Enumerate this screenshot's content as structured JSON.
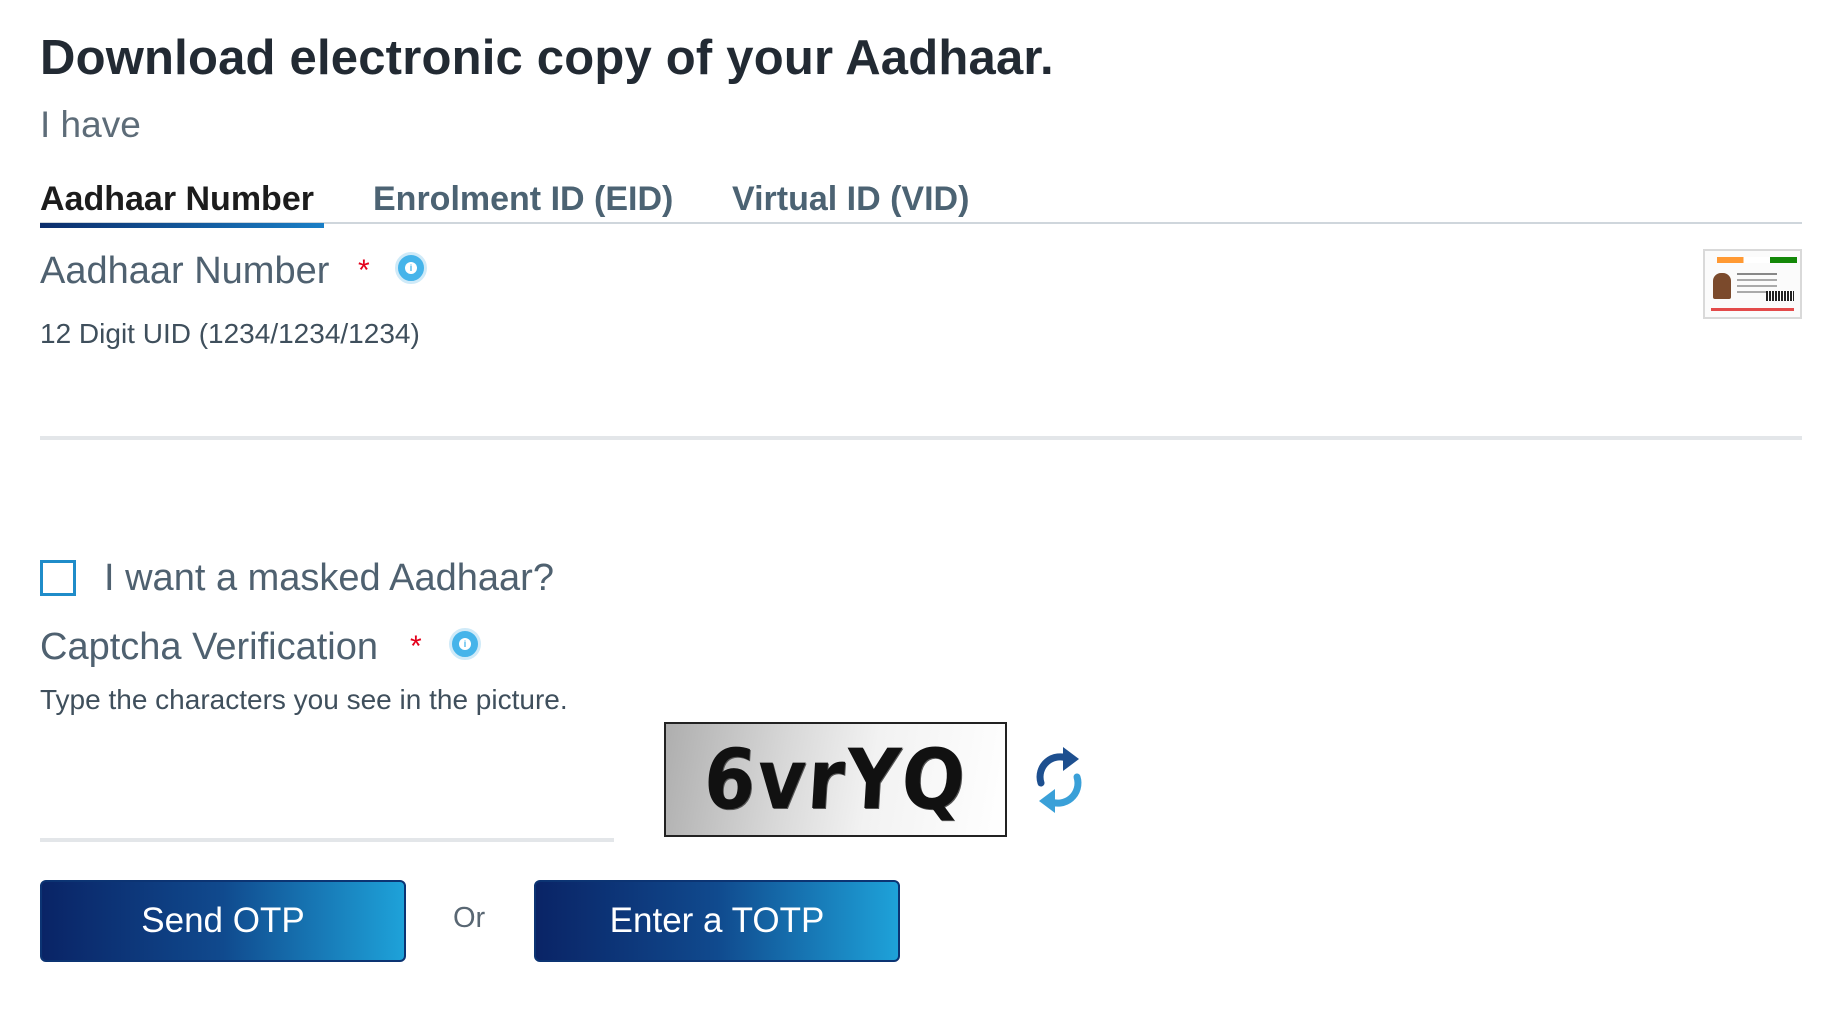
{
  "header": {
    "title": "Download electronic copy of your Aadhaar.",
    "subtitle": "I have"
  },
  "tabs": [
    {
      "label": "Aadhaar Number",
      "active": true
    },
    {
      "label": "Enrolment ID (EID)",
      "active": false
    },
    {
      "label": "Virtual ID (VID)",
      "active": false
    }
  ],
  "aadhaar_field": {
    "label": "Aadhaar Number",
    "required_mark": "*",
    "hint": "12 Digit UID (1234/1234/1234)",
    "value": "",
    "info_icon": "info-icon",
    "card_icon": "aadhaar-card-icon"
  },
  "masked": {
    "label": "I want a masked Aadhaar?",
    "checked": false
  },
  "captcha": {
    "label": "Captcha Verification",
    "required_mark": "*",
    "hint": "Type the characters you see in the picture.",
    "value": "",
    "image_text": "6vrYQ",
    "refresh_icon": "refresh-icon"
  },
  "actions": {
    "send_otp": "Send OTP",
    "or": "Or",
    "enter_totp": "Enter a TOTP"
  },
  "colors": {
    "accent": "#1a7fc6",
    "button_dark": "#0a2466",
    "button_light": "#1ea2d9",
    "required": "#e3001b",
    "info": "#45b4ea"
  }
}
